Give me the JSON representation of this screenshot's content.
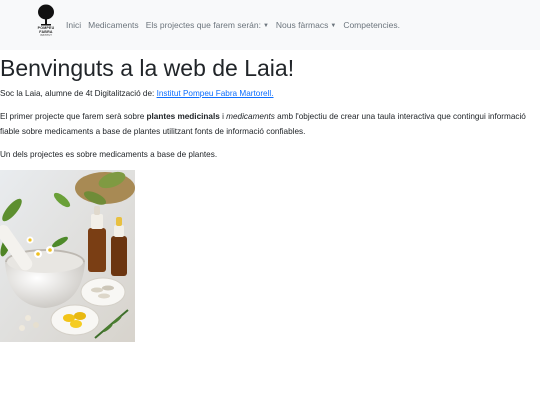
{
  "navbar": {
    "logo": {
      "line1": "POMPEU",
      "line2": "FABRA",
      "line3": "INSTITUT"
    },
    "items": [
      {
        "label": "Inici"
      },
      {
        "label": "Medicaments"
      },
      {
        "label": "Els projectes que farem serán:",
        "dropdown": true
      },
      {
        "label": "Nous fàrmacs",
        "dropdown": true
      },
      {
        "label": "Competencies."
      }
    ]
  },
  "main": {
    "title": "Benvinguts a la web de Laia!",
    "intro_text": "Soc la Laia, alumne de 4t Digitalització de: ",
    "intro_link": "Institut Pompeu Fabra Martorell.",
    "para2_a": "El primer projecte que farem serà sobre ",
    "para2_bold": "plantes medicinals",
    "para2_b": " i ",
    "para2_italic": "medicaments",
    "para2_c": " amb l'objectiu de crear una taula interactiva que contingui informació fiable sobre medicaments a base de plantes utilitzant fonts de informació confiables.",
    "para3": "Un dels projectes es sobre medicaments a base de plantes."
  },
  "colors": {
    "navbar_bg": "#f8f9fa",
    "nav_text": "#6c757d",
    "link": "#0d6efd"
  }
}
